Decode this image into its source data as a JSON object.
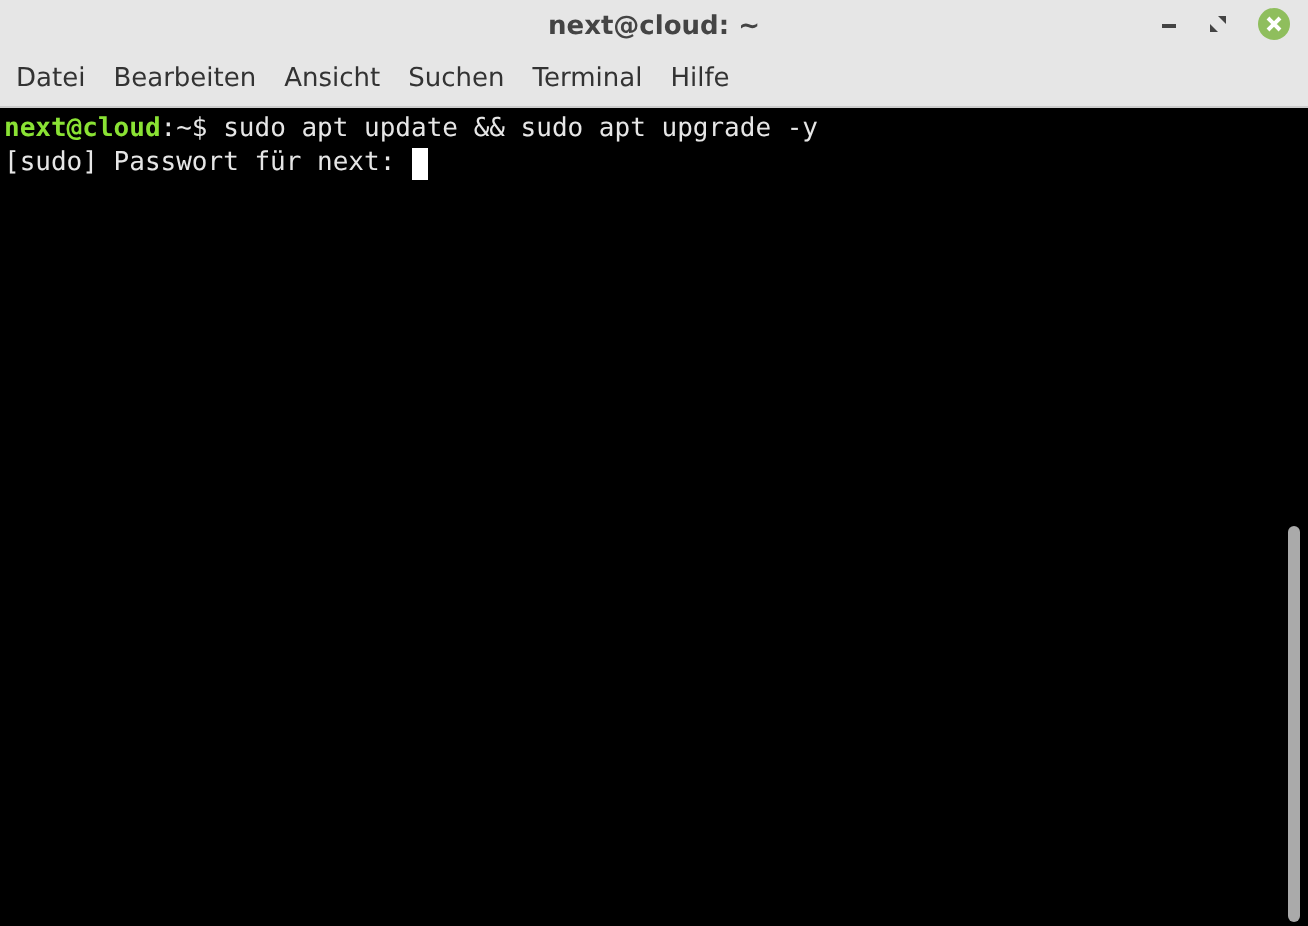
{
  "window": {
    "title": "next@cloud: ~"
  },
  "menu": [
    "Datei",
    "Bearbeiten",
    "Ansicht",
    "Suchen",
    "Terminal",
    "Hilfe"
  ],
  "terminal": {
    "lines": [
      {
        "kind": "prompt",
        "user_host": "next@cloud",
        "path": ":~$",
        "command": " sudo apt update && sudo apt upgrade -y"
      },
      {
        "kind": "output",
        "text": "[sudo] Passwort für next: ",
        "cursor": true
      }
    ]
  }
}
